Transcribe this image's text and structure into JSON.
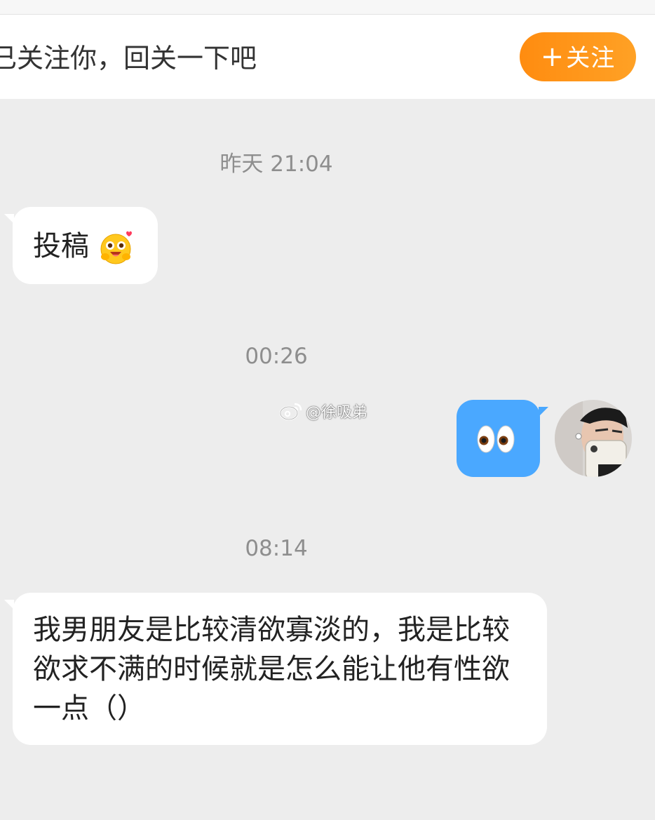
{
  "banner": {
    "text": "已关注你，回关一下吧",
    "follow_button": {
      "plus": "+",
      "label": "关注"
    }
  },
  "messages": [
    {
      "timestamp": "昨天 21:04",
      "side": "left",
      "text": "投稿",
      "emoji": "hug-face-emoji"
    },
    {
      "timestamp": "00:26",
      "side": "right",
      "emoji": "eyes-emoji"
    },
    {
      "timestamp": "08:14",
      "side": "left",
      "text": "我男朋友是比较清欲寡淡的，我是比较欲求不满的时候就是怎么能让他有性欲一点（）"
    }
  ],
  "watermark": "@徐吸弟",
  "colors": {
    "background": "#ededed",
    "accent_orange": "#ff8c10",
    "sent_bubble": "#4aa8ff",
    "received_bubble": "#ffffff",
    "timestamp_gray": "#8e8e8e"
  }
}
